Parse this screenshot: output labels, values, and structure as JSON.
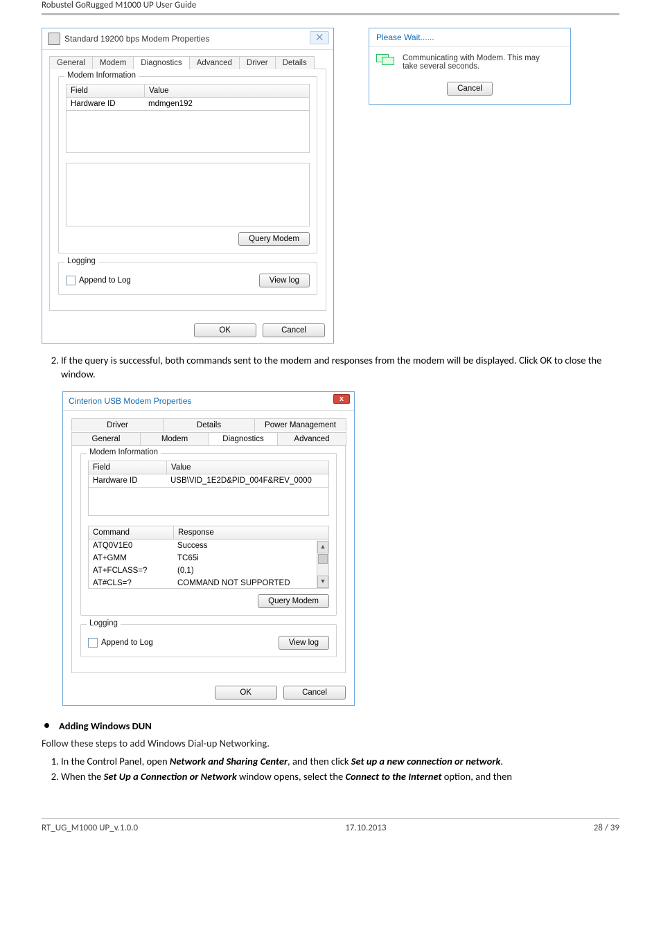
{
  "header": "Robustel GoRugged M1000 UP User Guide",
  "footer": {
    "left": "RT_UG_M1000 UP_v.1.0.0",
    "center": "17.10.2013",
    "right": "28 / 39"
  },
  "step2_text": "If the query is successful, both commands sent to the modem and responses from the modem will be displayed. Click OK to close the window.",
  "section_heading": "Adding Windows DUN",
  "follow_text": "Follow these steps to add Windows Dial-up Networking.",
  "step_list": [
    {
      "n": "1.",
      "pre": "In the Control Panel, open ",
      "b1": "Network and Sharing Center",
      "mid": ", and then click ",
      "b2": "Set up a new connection or network",
      "post": "."
    },
    {
      "n": "2.",
      "pre": "When the ",
      "b1": "Set Up a Connection or Network",
      "mid": " window opens, select the ",
      "b2": "Connect to the Internet",
      "post": " option, and then"
    }
  ],
  "dialog1": {
    "title": "Standard 19200 bps Modem Properties",
    "tabs": [
      "General",
      "Modem",
      "Diagnostics",
      "Advanced",
      "Driver",
      "Details"
    ],
    "active_tab": "Diagnostics",
    "group_info": "Modem Information",
    "col_field": "Field",
    "col_value": "Value",
    "row_field": "Hardware ID",
    "row_value": "mdmgen192",
    "query_btn": "Query Modem",
    "group_logging": "Logging",
    "append_label": "Append to Log",
    "viewlog_btn": "View log",
    "ok": "OK",
    "cancel": "Cancel"
  },
  "wait": {
    "title": "Please Wait......",
    "msg1": "Communicating with Modem. This may",
    "msg2": "take several seconds.",
    "cancel": "Cancel"
  },
  "dialog2": {
    "title": "Cinterion USB Modem Properties",
    "tabs_top": [
      "Driver",
      "Details",
      "Power Management"
    ],
    "tabs_bottom": [
      "General",
      "Modem",
      "Diagnostics",
      "Advanced"
    ],
    "active_tab": "Diagnostics",
    "group_info": "Modem Information",
    "col_field": "Field",
    "col_value": "Value",
    "row_field": "Hardware ID",
    "row_value": "USB\\VID_1E2D&PID_004F&REV_0000",
    "col_cmd": "Command",
    "col_resp": "Response",
    "cmds": [
      {
        "cmd": "ATQ0V1E0",
        "resp": "Success"
      },
      {
        "cmd": "AT+GMM",
        "resp": "TC65i"
      },
      {
        "cmd": "AT+FCLASS=?",
        "resp": "(0,1)"
      },
      {
        "cmd": "AT#CLS=?",
        "resp": "COMMAND NOT SUPPORTED"
      }
    ],
    "query_btn": "Query Modem",
    "group_logging": "Logging",
    "append_label": "Append to Log",
    "viewlog_btn": "View log",
    "ok": "OK",
    "cancel": "Cancel"
  }
}
